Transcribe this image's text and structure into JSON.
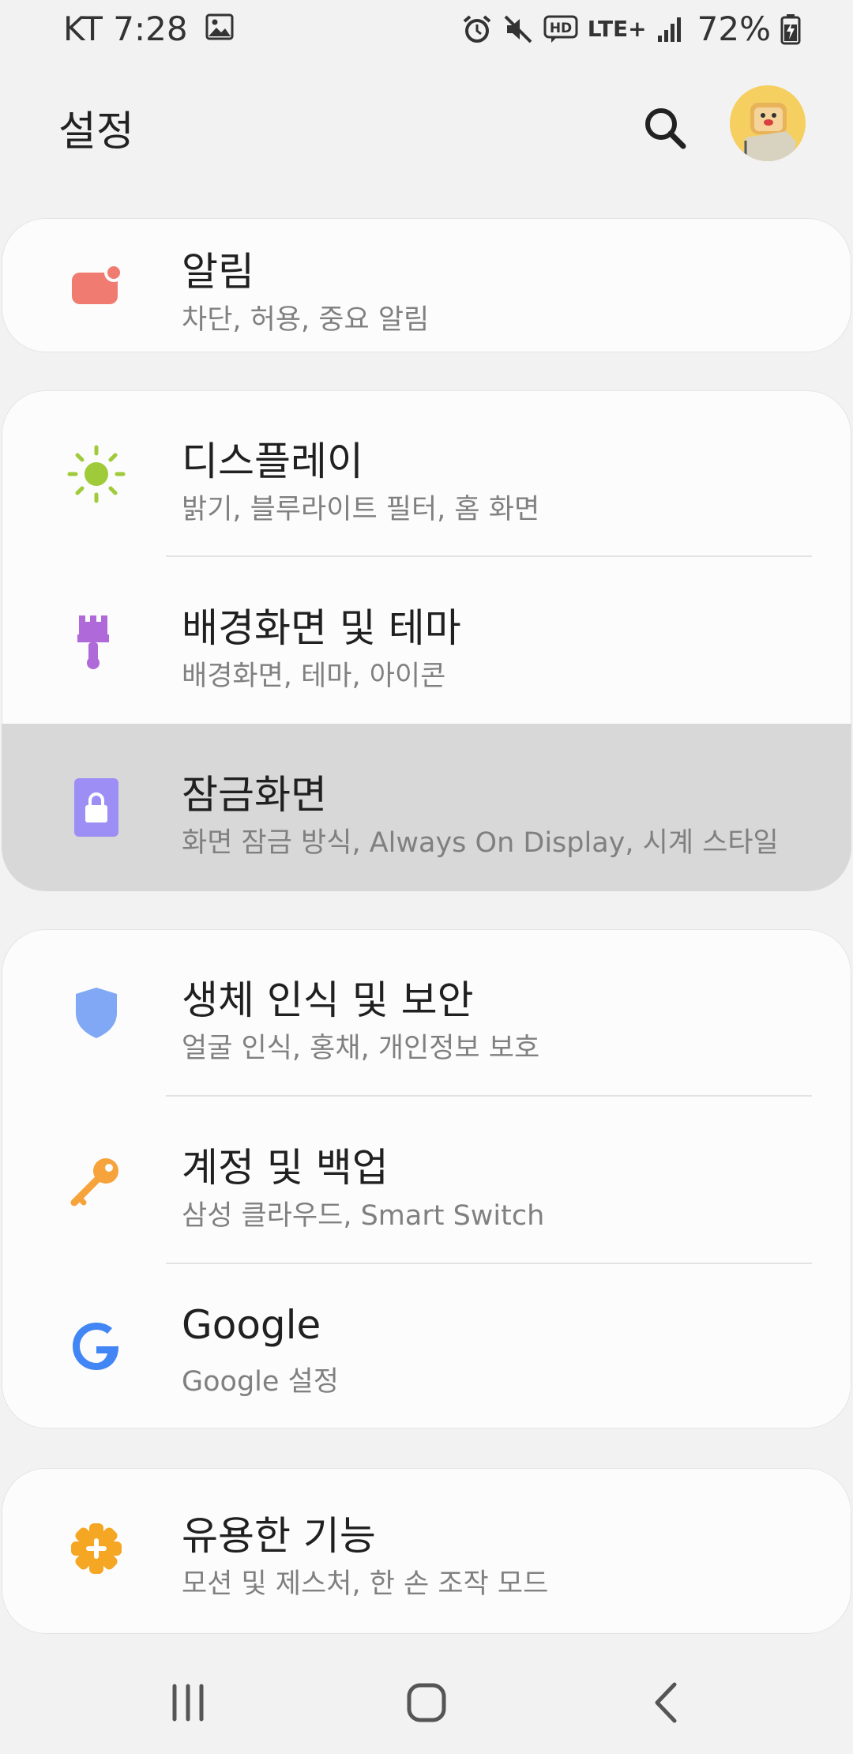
{
  "status_bar": {
    "carrier": "KT",
    "time": "7:28",
    "network": "LTE+",
    "hd_label": "HD",
    "battery": "72%",
    "icons": [
      "gallery-icon",
      "alarm-icon",
      "mute-icon",
      "hd-voice-icon",
      "lte-icon",
      "signal-icon",
      "battery-charging-icon"
    ]
  },
  "app_bar": {
    "title": "설정"
  },
  "groups": [
    {
      "items": [
        {
          "id": "notifications",
          "title": "알림",
          "subtitle": "차단, 허용, 중요 알림",
          "icon": "notification-icon",
          "color": "#f07b70"
        }
      ]
    },
    {
      "items": [
        {
          "id": "display",
          "title": "디스플레이",
          "subtitle": "밝기, 블루라이트 필터, 홈 화면",
          "icon": "brightness-icon",
          "color": "#9fcb3a"
        },
        {
          "id": "themes",
          "title": "배경화면 및 테마",
          "subtitle": "배경화면, 테마, 아이콘",
          "icon": "paint-brush-icon",
          "color": "#b069d9"
        },
        {
          "id": "lock-screen",
          "title": "잠금화면",
          "subtitle": "화면 잠금 방식, Always On Display, 시계 스타일",
          "icon": "lock-icon",
          "color": "#9c8ef5",
          "pressed": true
        }
      ]
    },
    {
      "items": [
        {
          "id": "biometrics",
          "title": "생체 인식 및 보안",
          "subtitle": "얼굴 인식, 홍채, 개인정보 보호",
          "icon": "shield-icon",
          "color": "#80a8f5"
        },
        {
          "id": "accounts",
          "title": "계정 및 백업",
          "subtitle": "삼성 클라우드, Smart Switch",
          "icon": "key-icon",
          "color": "#f5a33a"
        },
        {
          "id": "google",
          "title": "Google",
          "subtitle": "Google 설정",
          "icon": "google-icon",
          "color": "#4285f4"
        }
      ]
    },
    {
      "items": [
        {
          "id": "advanced",
          "title": "유용한 기능",
          "subtitle": "모션 및 제스처, 한 손 조작 모드",
          "icon": "advanced-features-icon",
          "color": "#f5a623"
        }
      ]
    }
  ],
  "nav_bar": {
    "buttons": [
      "recent-apps-icon",
      "home-icon",
      "back-icon"
    ]
  }
}
